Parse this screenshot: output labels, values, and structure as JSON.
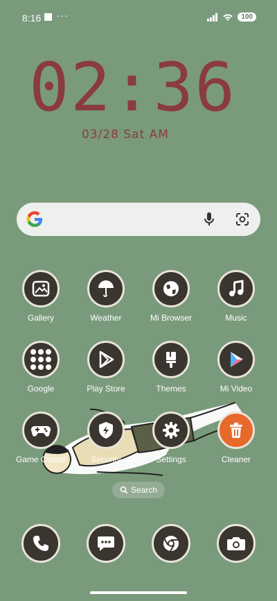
{
  "status": {
    "time": "8:16",
    "dots": "···",
    "battery": "100"
  },
  "clock": {
    "time": "02:36",
    "date": "03/28 Sat AM"
  },
  "apps": [
    {
      "label": "Gallery",
      "icon": "gallery-icon"
    },
    {
      "label": "Weather",
      "icon": "umbrella-icon"
    },
    {
      "label": "Mi Browser",
      "icon": "globe-icon"
    },
    {
      "label": "Music",
      "icon": "music-note-icon"
    },
    {
      "label": "Google",
      "icon": "google-folder-icon"
    },
    {
      "label": "Play Store",
      "icon": "play-store-icon"
    },
    {
      "label": "Themes",
      "icon": "paint-brush-icon"
    },
    {
      "label": "Mi Video",
      "icon": "video-play-icon"
    },
    {
      "label": "Game Center",
      "icon": "gamepad-icon"
    },
    {
      "label": "Security",
      "icon": "shield-icon"
    },
    {
      "label": "Settings",
      "icon": "gear-icon"
    },
    {
      "label": "Cleaner",
      "icon": "trash-icon"
    }
  ],
  "search_pill": {
    "label": "Search"
  },
  "dock": [
    {
      "icon": "phone-icon"
    },
    {
      "icon": "messages-icon"
    },
    {
      "icon": "chrome-icon"
    },
    {
      "icon": "camera-icon"
    }
  ]
}
